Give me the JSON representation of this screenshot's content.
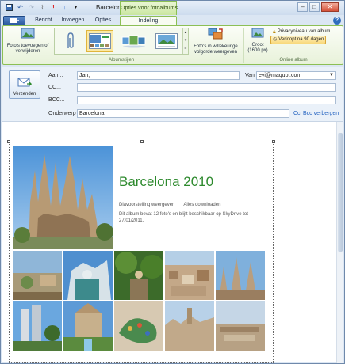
{
  "window": {
    "title": "Barcelona!",
    "context_tab_group": "Opties voor fotoalbums"
  },
  "tabs": [
    {
      "label": "Bericht"
    },
    {
      "label": "Invoegen"
    },
    {
      "label": "Opties"
    },
    {
      "label": "Indeling",
      "active": true
    }
  ],
  "ribbon": {
    "remove_photos_label": "Foto's toevoegen of verwijderen",
    "album_styles_group": "Albumstijlen",
    "shuffle_label": "Foto's in willekeurige volgorde weergeven",
    "size_label": "Groot (1600 px)",
    "privacy_label": "Privacyniveau van album",
    "expiry_label": "Verloopt na 90 dagen",
    "online_album_group": "Online album"
  },
  "compose": {
    "send_label": "Verzenden",
    "to_label": "Aan...",
    "to_value": "Jan;",
    "cc_label": "CC...",
    "cc_value": "",
    "bcc_label": "BCC...",
    "bcc_value": "",
    "subject_label": "Onderwerp",
    "subject_value": "Barcelona!",
    "from_label": "Van",
    "from_value": "evi@maquoi.com",
    "cc_link": "Cc",
    "hide_bcc_link": "Bcc verbergen"
  },
  "album": {
    "title": "Barcelona 2010",
    "slideshow_link": "Diavoorstelling weergeven",
    "download_link": "Alles downloaden",
    "description": "Dit album bevat 12 foto's en blijft beschikbaar op SkyDrive tot 27/01/2011."
  },
  "colors": {
    "accent_green": "#2e8a2e",
    "context_green": "#8cbf55",
    "link_blue": "#1f5fbf"
  }
}
